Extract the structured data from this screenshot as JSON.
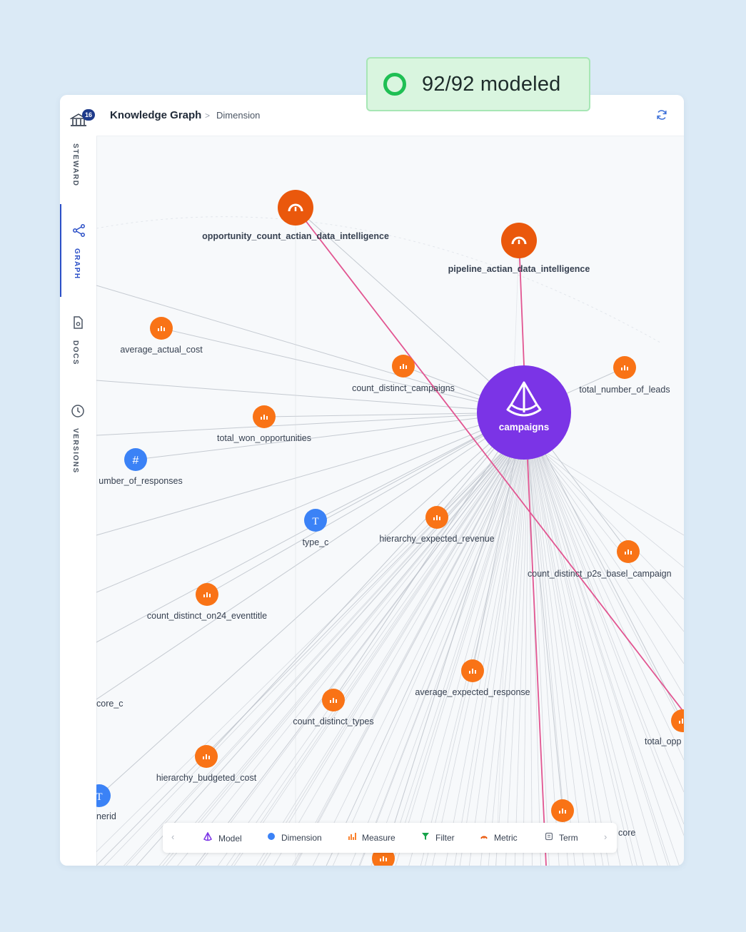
{
  "badge": {
    "text": "92/92 modeled",
    "color": "#1fbf54"
  },
  "sidebar": {
    "count": "16",
    "items": [
      {
        "label": "STEWARD",
        "icon": "bank-icon"
      },
      {
        "label": "GRAPH",
        "icon": "share-graph-icon",
        "active": true
      },
      {
        "label": "DOCS",
        "icon": "document-icon"
      },
      {
        "label": "VERSIONS",
        "icon": "clock-icon"
      }
    ]
  },
  "header": {
    "title": "Knowledge Graph",
    "separator": ">",
    "current": "Dimension"
  },
  "colors": {
    "model": "#7b34e6",
    "dimension": "#3b82f6",
    "measure": "#f97316",
    "metric": "#ea580c",
    "filter": "#16a34a",
    "edge": "#b8bec7",
    "highlight": "#e25591"
  },
  "graph": {
    "center": {
      "label": "campaigns",
      "type": "model"
    },
    "nodes": [
      {
        "label": "opportunity_count_actian_data_intelligence",
        "type": "metric"
      },
      {
        "label": "pipeline_actian_data_intelligence",
        "type": "metric"
      },
      {
        "label": "average_actual_cost",
        "type": "measure"
      },
      {
        "label": "count_distinct_campaigns",
        "type": "measure"
      },
      {
        "label": "total_number_of_leads",
        "type": "measure"
      },
      {
        "label": "total_won_opportunities",
        "type": "measure"
      },
      {
        "label": "umber_of_responses",
        "type": "dimension-number"
      },
      {
        "label": "type_c",
        "type": "dimension-text"
      },
      {
        "label": "hierarchy_expected_revenue",
        "type": "measure"
      },
      {
        "label": "count_distinct_p2s_basel_campaign",
        "type": "measure"
      },
      {
        "label": "count_distinct_on24_eventtitle",
        "type": "measure"
      },
      {
        "label": "average_expected_response",
        "type": "measure"
      },
      {
        "label": "core_c",
        "type": "label-only"
      },
      {
        "label": "count_distinct_types",
        "type": "measure"
      },
      {
        "label": "total_opp",
        "type": "measure"
      },
      {
        "label": "hierarchy_budgeted_cost",
        "type": "measure"
      },
      {
        "label": "nerid",
        "type": "dimension-text"
      },
      {
        "label": "core",
        "type": "label-only"
      },
      {
        "label": "",
        "type": "measure"
      },
      {
        "label": "",
        "type": "measure"
      }
    ]
  },
  "legend": {
    "items": [
      {
        "label": "Model",
        "icon": "model-icon"
      },
      {
        "label": "Dimension",
        "icon": "dimension-dot-icon"
      },
      {
        "label": "Measure",
        "icon": "measure-bars-icon"
      },
      {
        "label": "Filter",
        "icon": "filter-icon"
      },
      {
        "label": "Metric",
        "icon": "metric-gauge-icon"
      },
      {
        "label": "Term",
        "icon": "term-book-icon"
      }
    ],
    "prev": "‹",
    "next": "›"
  }
}
